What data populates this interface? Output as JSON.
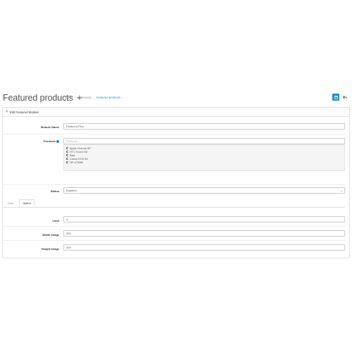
{
  "header": {
    "title": "Featured products",
    "plus": "+",
    "breadcrumb": [
      "Home",
      "Extensions",
      "Featured products"
    ]
  },
  "colors": {
    "accent": "#1e91cf"
  },
  "panel": {
    "heading": "Edit Featured Module"
  },
  "form": {
    "module_name_label": "Module Name",
    "module_name_value": "Featured Plus",
    "products_label": "Products",
    "products_placeholder": "Products",
    "products": [
      "Apple Cinema 30\"",
      "HTC Touch HD",
      "iMac",
      "Canon EOS 5D",
      "HP LP3065"
    ],
    "status_label": "Status",
    "status_value": "Enabled",
    "tabs": [
      "Data",
      "Option"
    ],
    "limit_label": "Limit",
    "limit_value": "4",
    "width_label": "Width Image",
    "width_value": "200",
    "height_label": "Height Image",
    "height_value": "200"
  }
}
